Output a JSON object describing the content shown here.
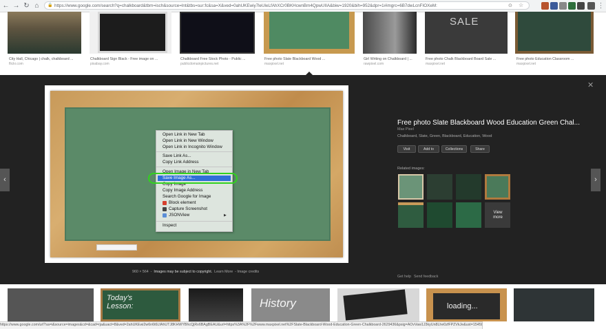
{
  "browser": {
    "url": "https://www.google.com/search?q=chalkboard&tbm=isch&source=lnt&tbs=sur:fc&sa=X&ved=0ahUKEwiy7leUleLfAhXCr0BKHcwnBm4QpwUIIA&biw=1920&bih=952&dpr=1#imgrc=6B7dwLcnFIOXeM:"
  },
  "results_top": [
    {
      "caption": "City Hall, Chicago | chalk, chalkboard ...",
      "source": "flickr.com"
    },
    {
      "caption": "Chalkboard Sign Black - Free image on ...",
      "source": "pixabay.com"
    },
    {
      "caption": "Chalkboard Free Stock Photo - Public ...",
      "source": "publicdomainpictures.net"
    },
    {
      "caption": "Free photo Slate Blackboard Wood ...",
      "source": "maxpixel.net"
    },
    {
      "caption": "Girl Writing on Chalkboard | ...",
      "source": "rawpixel.com"
    },
    {
      "caption": "Free photo Chalk Blackboard Board Sale ...",
      "source": "maxpixel.net"
    },
    {
      "caption": "Free photo Education Classroom ...",
      "source": "maxpixel.net"
    }
  ],
  "sale_text": "SALE",
  "context_menu": {
    "items": [
      "Open Link in New Tab",
      "Open Link in New Window",
      "Open Link in Incognito Window",
      "Save Link As...",
      "Copy Link Address",
      "Open Image in New Tab",
      "Save Image As...",
      "Copy Image",
      "Copy Image Address",
      "Search Google for Image",
      "Block element",
      "Capture Screenshot",
      "JSONView",
      "Inspect"
    ],
    "submenu_arrow": "▶"
  },
  "preview": {
    "size": "960 × 564",
    "copyright": "Images may be subject to copyright.",
    "learn_more": "Learn More",
    "credits": "Image credits",
    "title": "Free photo Slate Blackboard Wood Education Green Chal...",
    "site": "Max Pixel",
    "tags": "Chalkboard, Slate, Green, Blackboard, Education, Wood",
    "buttons": [
      "Visit",
      "Add to",
      "Collections",
      "Share"
    ],
    "related_label": "Related images:",
    "view_more": "View more",
    "get_help": "Get help",
    "send_feedback": "Send feedback",
    "close": "✕",
    "prev": "‹",
    "next": "›"
  },
  "bottom_texts": {
    "today": "Today's Lesson:",
    "history": "History",
    "loading": "loading..."
  },
  "status_url": "https://www.google.com/url?sa=i&source=images&cd=&cad=rja&uact=8&ved=2ahUKEwi2w6n6t6LfAhUTJ8KHWYBhcQjRx6BAgBEAU&url=https%3A%2F%2Fwww.maxpixel.net%2FSlate-Blackboard-Wood-Education-Green-Chalkboard-2629436&psig=AOvVaw1J3kyUn8Lhe0zfFPZVkJe&ust=1545875530317196..."
}
